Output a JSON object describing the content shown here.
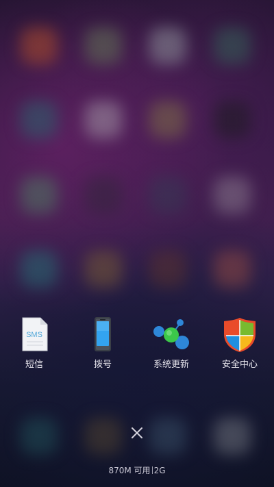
{
  "recent_apps": [
    {
      "label": "短信",
      "icon": "sms-icon"
    },
    {
      "label": "拨号",
      "icon": "phone-icon"
    },
    {
      "label": "系统更新",
      "icon": "system-update-icon"
    },
    {
      "label": "安全中心",
      "icon": "security-center-icon"
    }
  ],
  "controls": {
    "close_icon": "close-icon"
  },
  "status": {
    "memory_free": "870M 可用",
    "memory_total": "2G"
  },
  "colors": {
    "label_text": "#e6e4ec",
    "close_icon": "#d8d6e0",
    "sms_blue": "#4fa6d8",
    "phone_blue": "#33a3f0",
    "update_green": "#3cc84a",
    "update_blue": "#2e87d8",
    "shield_red": "#e94b2a",
    "shield_green": "#78bb2f",
    "shield_blue": "#1f8fe0",
    "shield_yellow": "#f7b91c"
  }
}
